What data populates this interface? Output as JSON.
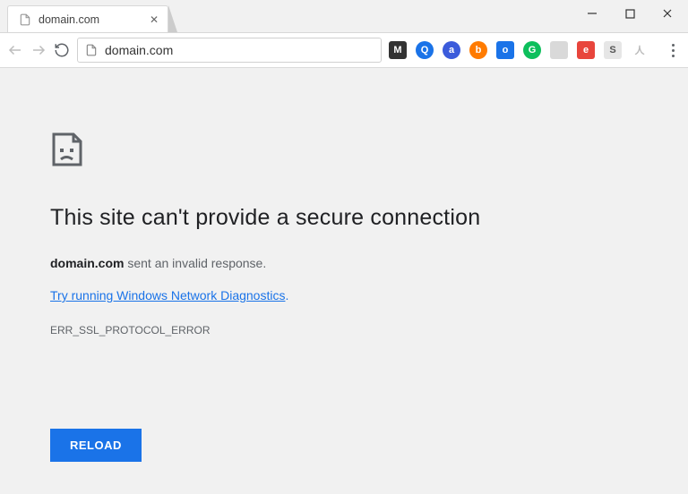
{
  "window": {
    "controls": {
      "minimize": "–",
      "maximize": "☐",
      "close": "✕"
    }
  },
  "tab": {
    "title": "domain.com"
  },
  "address_bar": {
    "url": "domain.com"
  },
  "extensions": [
    {
      "label": "M",
      "bg": "#333333",
      "shape": "square"
    },
    {
      "label": "Q",
      "bg": "#1a73e8",
      "shape": "circle"
    },
    {
      "label": "a",
      "bg": "#3b5bdb",
      "shape": "circle"
    },
    {
      "label": "b",
      "bg": "#ff7b00",
      "shape": "circle"
    },
    {
      "label": "o",
      "bg": "#1a73e8",
      "shape": "square"
    },
    {
      "label": "G",
      "bg": "#0dbf5c",
      "shape": "circle"
    },
    {
      "label": " ",
      "bg": "#d9d9d9",
      "shape": "square"
    },
    {
      "label": "e",
      "bg": "#e8453c",
      "shape": "square"
    },
    {
      "label": "S",
      "bg": "#e6e6e6",
      "shape": "square",
      "fg": "#555"
    },
    {
      "label": "人",
      "bg": "transparent",
      "shape": "square",
      "fg": "#bbb"
    }
  ],
  "error": {
    "title": "This site can't provide a secure connection",
    "domain": "domain.com",
    "message_suffix": " sent an invalid response.",
    "link_text": "Try running Windows Network Diagnostics",
    "link_period": ".",
    "code": "ERR_SSL_PROTOCOL_ERROR",
    "reload_label": "RELOAD"
  }
}
